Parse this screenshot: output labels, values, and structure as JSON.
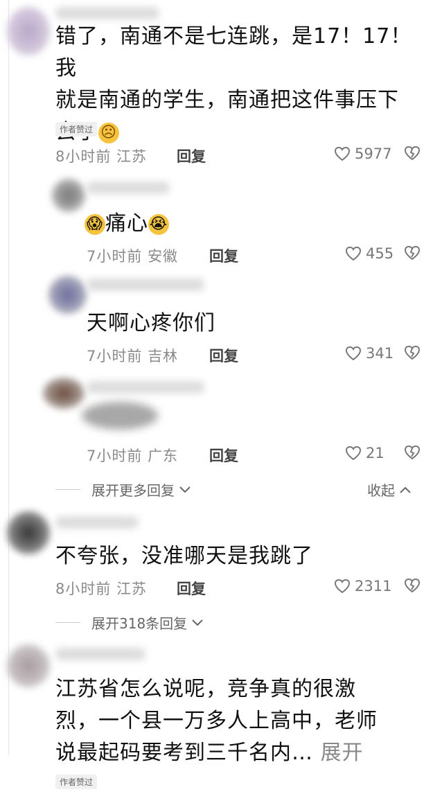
{
  "comments": [
    {
      "text_line1": "错了，南通不是七连跳，是17！17！我",
      "text_line2": "就是南通的学生，南通把这件事压下",
      "text_line3": "去了",
      "author_tag": "作者赞过",
      "time": "8小时前",
      "location": "江苏",
      "reply_label": "回复",
      "likes": "5977"
    },
    {
      "text": "痛心",
      "time": "7小时前",
      "location": "安徽",
      "reply_label": "回复",
      "likes": "455"
    },
    {
      "text": "天啊心疼你们",
      "time": "7小时前",
      "location": "吉林",
      "reply_label": "回复",
      "likes": "341"
    },
    {
      "time": "7小时前",
      "location": "广东",
      "reply_label": "回复",
      "likes": "21"
    },
    {
      "text": "不夸张，没准哪天是我跳了",
      "time": "8小时前",
      "location": "江苏",
      "reply_label": "回复",
      "likes": "2311"
    },
    {
      "text_line1": "江苏省怎么说呢，竞争真的很激",
      "text_line2": "烈，一个县一万多人上高中，老师",
      "text_line3": "说最起码要考到三千名内…",
      "expand_inline": "展开",
      "author_tag": "作者赞过"
    }
  ],
  "expand_more": "展开更多回复",
  "collapse": "收起",
  "expand_318": "展开318条回复",
  "icons": [
    "heart-icon",
    "broken-heart-icon",
    "chevron-down-icon",
    "chevron-up-icon",
    "frown-emoji",
    "scream-emoji",
    "crying-emoji"
  ]
}
